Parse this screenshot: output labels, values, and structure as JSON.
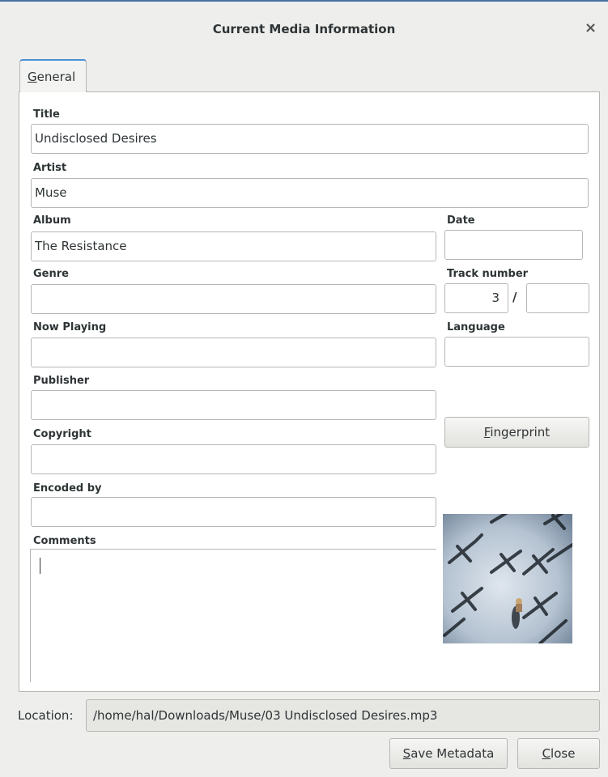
{
  "window": {
    "title": "Current Media Information",
    "close_glyph": "×"
  },
  "tabs": [
    {
      "mnemonic": "G",
      "rest": "eneral"
    }
  ],
  "fields": {
    "title": {
      "label": "Title",
      "value": "Undisclosed Desires"
    },
    "artist": {
      "label": "Artist",
      "value": "Muse"
    },
    "album": {
      "label": "Album",
      "value": "The Resistance"
    },
    "date": {
      "label": "Date",
      "value": ""
    },
    "genre": {
      "label": "Genre",
      "value": ""
    },
    "track_number": {
      "label": "Track number",
      "value": "3",
      "total": "",
      "separator": "/"
    },
    "now_playing": {
      "label": "Now Playing",
      "value": ""
    },
    "language": {
      "label": "Language",
      "value": ""
    },
    "publisher": {
      "label": "Publisher",
      "value": ""
    },
    "copyright": {
      "label": "Copyright",
      "value": ""
    },
    "encoded_by": {
      "label": "Encoded by",
      "value": ""
    },
    "comments": {
      "label": "Comments",
      "value": ""
    }
  },
  "buttons": {
    "fingerprint": {
      "mnemonic": "F",
      "rest": "ingerprint"
    },
    "save_metadata": {
      "mnemonic": "S",
      "rest": "ave Metadata"
    },
    "close": {
      "mnemonic": "C",
      "rest": "lose"
    }
  },
  "location": {
    "label": "Location:",
    "value": "/home/hal/Downloads/Muse/03 Undisclosed Desires.mp3"
  },
  "icons": {
    "close": "close-icon",
    "album_art": "album-cover-image"
  },
  "colors": {
    "accent": "#4a90d9",
    "window_bg": "#eeeeec",
    "border": "#b6b6b3"
  }
}
